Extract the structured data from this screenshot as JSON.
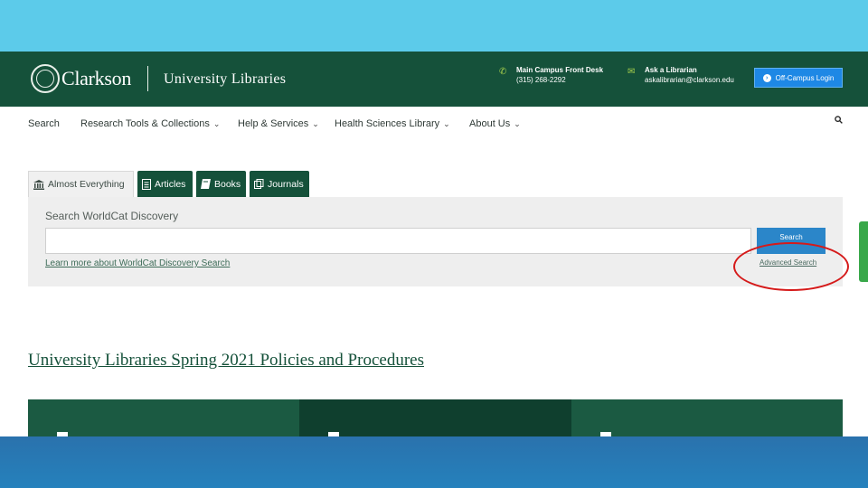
{
  "header": {
    "brand": "Clarkson",
    "site_name": "University Libraries",
    "contacts": [
      {
        "label": "Main Campus Front Desk",
        "value": "(315) 268-2292",
        "icon": "phone-icon"
      },
      {
        "label": "Ask a Librarian",
        "value": "askalibrarian@clarkson.edu",
        "icon": "mail-icon"
      }
    ],
    "login_label": "Off-Campus Login"
  },
  "nav": {
    "items": [
      {
        "label": "Search",
        "dropdown": false
      },
      {
        "label": "Research Tools & Collections",
        "dropdown": true
      },
      {
        "label": "Help & Services",
        "dropdown": true
      },
      {
        "label": "Health Sciences Library",
        "dropdown": true
      },
      {
        "label": "About Us",
        "dropdown": true
      }
    ],
    "chevron": "⌄"
  },
  "tabs": [
    {
      "label": "Almost Everything",
      "icon": "building-icon",
      "active": true
    },
    {
      "label": "Articles",
      "icon": "article-icon",
      "active": false
    },
    {
      "label": "Books",
      "icon": "book-icon",
      "active": false
    },
    {
      "label": "Journals",
      "icon": "journal-icon",
      "active": false
    }
  ],
  "search": {
    "title": "Search WorldCat Discovery",
    "input_value": "",
    "placeholder": "",
    "button_label": "Search",
    "learn_more": "Learn more about WorldCat Discovery Search",
    "advanced": "Advanced Search"
  },
  "policies_title": "University Libraries Spring 2021 Policies and Procedures",
  "colors": {
    "brand_green": "#15513a",
    "accent_blue": "#1e88e5",
    "annotation_red": "#d51a1a"
  }
}
